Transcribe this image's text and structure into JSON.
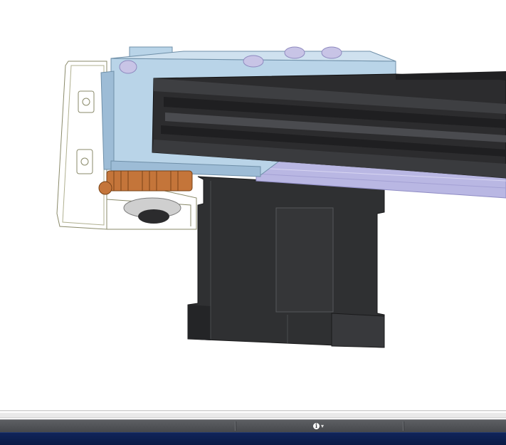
{
  "viewport": {
    "background": "#ffffff",
    "colors": {
      "extrusion_dark": "#2c2c2e",
      "extrusion_mid": "#3e3f42",
      "plate_light_blue": "#b9d4e8",
      "plate_blue_shade": "#9dbcd6",
      "motor_black": "#2f3032",
      "motor_side": "#242527",
      "bolt_lavender": "#c8c4e6",
      "rail_lavender": "#b9b7e3",
      "gear_orange": "#c4753a",
      "wireframe_outline": "#8a8a6a"
    },
    "parts": [
      "aluminum-extrusion",
      "light-blue-mounting-plate",
      "stepper-motor",
      "extruder-gears",
      "transparent-extruder-housing",
      "lavender-bolts",
      "linear-rail"
    ]
  },
  "status_bar": {
    "info_icon": "info-icon",
    "info_glyph": "i",
    "dropdown_glyph": "▾"
  }
}
